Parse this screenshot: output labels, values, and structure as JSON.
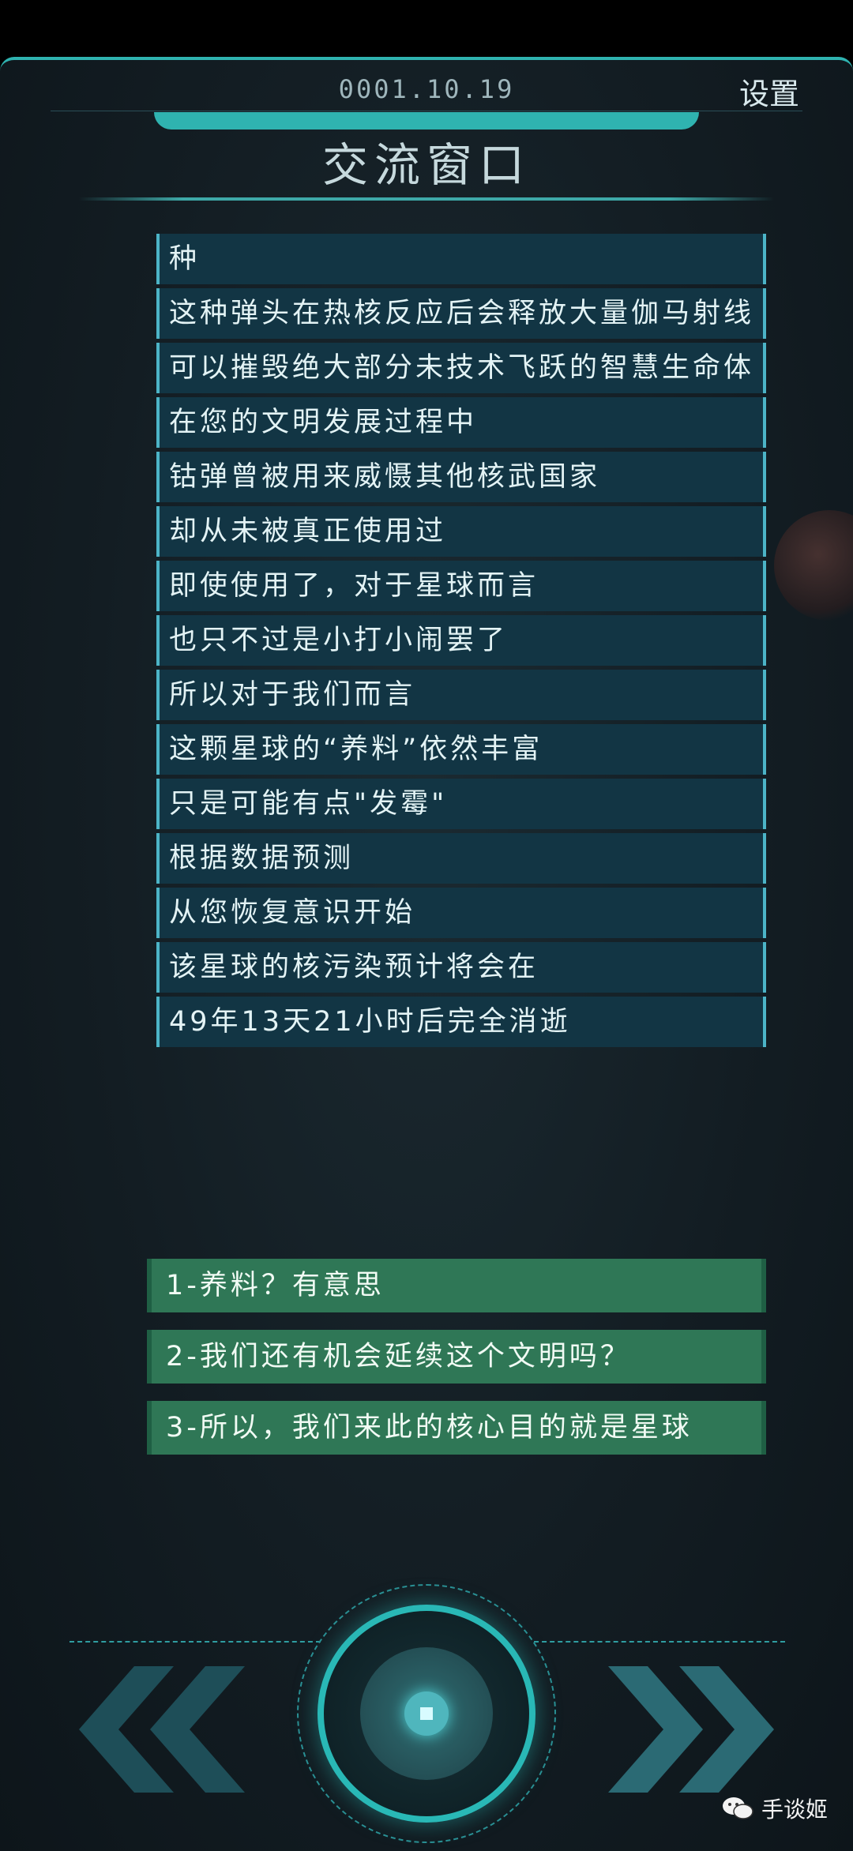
{
  "header": {
    "date": "0001.10.19",
    "settings_label": "设置",
    "title": "交流窗口"
  },
  "messages": [
    "种",
    "这种弹头在热核反应后会释放大量伽马射线",
    "可以摧毁绝大部分未技术飞跃的智慧生命体",
    "在您的文明发展过程中",
    "钴弹曾被用来威慑其他核武国家",
    "却从未被真正使用过",
    "即使使用了，对于星球而言",
    "也只不过是小打小闹罢了",
    "所以对于我们而言",
    "这颗星球的“养料”依然丰富",
    "只是可能有点\"发霉\"",
    "根据数据预测",
    "从您恢复意识开始",
    "该星球的核污染预计将会在",
    "49年13天21小时后完全消逝"
  ],
  "options": [
    "1-养料？有意思",
    "2-我们还有机会延续这个文明吗？",
    "3-所以，我们来此的核心目的就是星球"
  ],
  "controls": {
    "prev_icon": "double-chevron-left-icon",
    "next_icon": "double-chevron-right-icon",
    "core_icon": "core-button-icon"
  },
  "watermark": {
    "text": "手谈姬",
    "icon": "wechat-icon"
  },
  "colors": {
    "accent": "#2fb3b0",
    "message_bg": "#123544",
    "option_bg": "#2f7756"
  }
}
